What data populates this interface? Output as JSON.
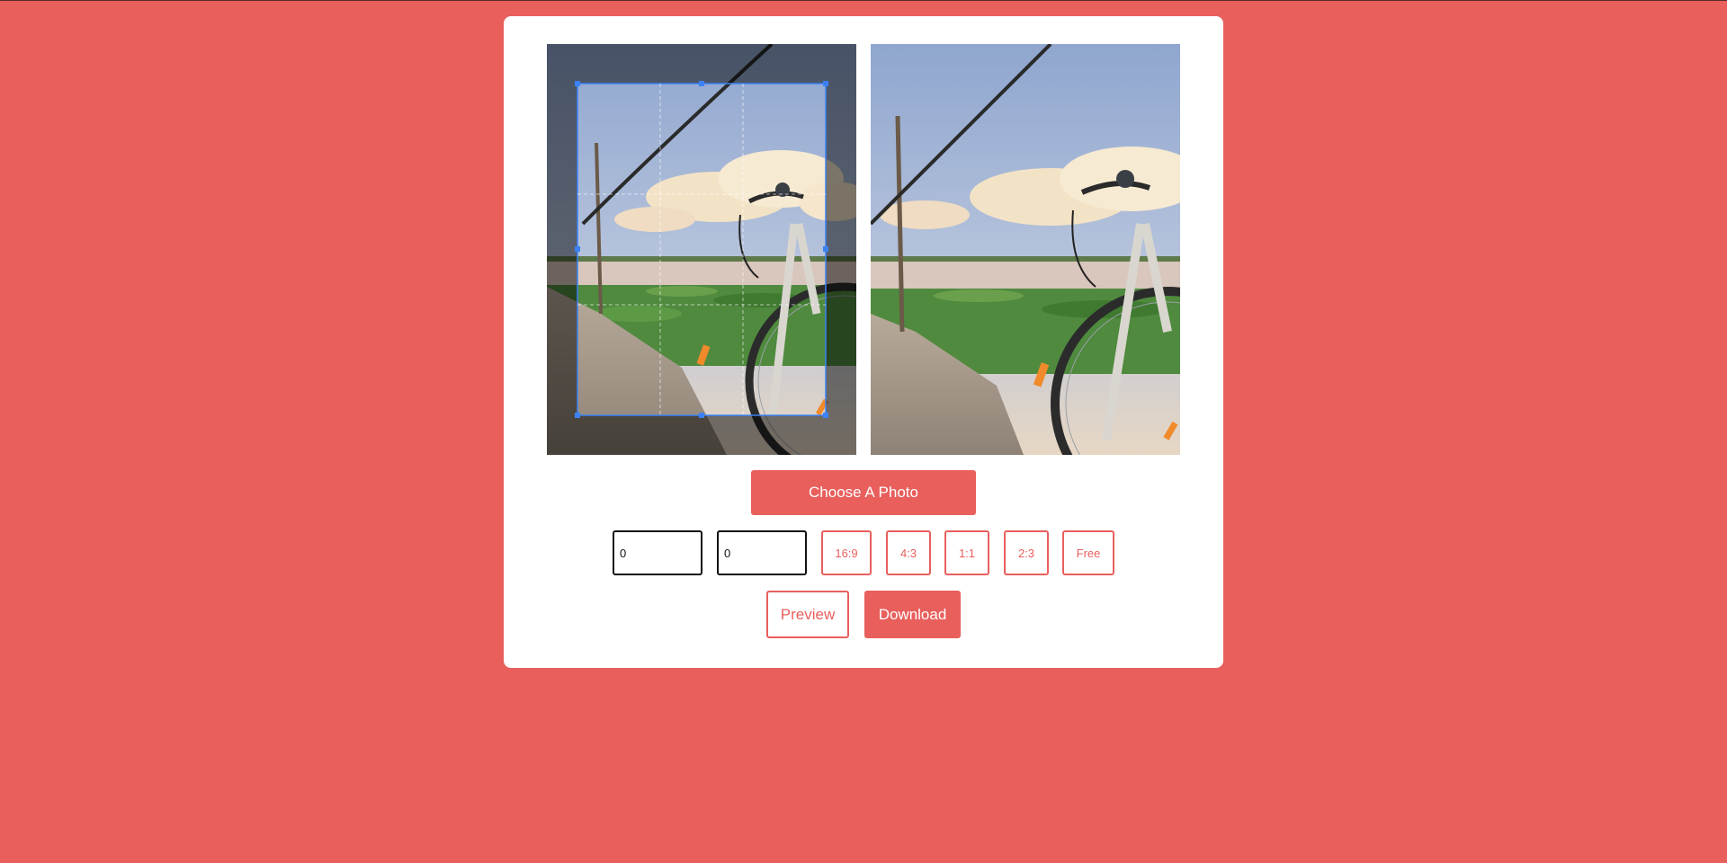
{
  "colors": {
    "background": "#e85f5c",
    "card": "#ffffff",
    "accent": "#e85f5c",
    "crop_border": "#3b82f6"
  },
  "editor": {
    "image_content": "photo of a bicycle beside a flooded field with clouds at sunset",
    "crop_guides": true
  },
  "preview": {
    "image_content": "cropped preview of the bicycle photo"
  },
  "actions": {
    "choose_photo_label": "Choose A Photo",
    "preview_label": "Preview",
    "download_label": "Download"
  },
  "dimensions": {
    "width_value": "0",
    "height_value": "0"
  },
  "aspect_ratios": [
    "16:9",
    "4:3",
    "1:1",
    "2:3",
    "Free"
  ]
}
